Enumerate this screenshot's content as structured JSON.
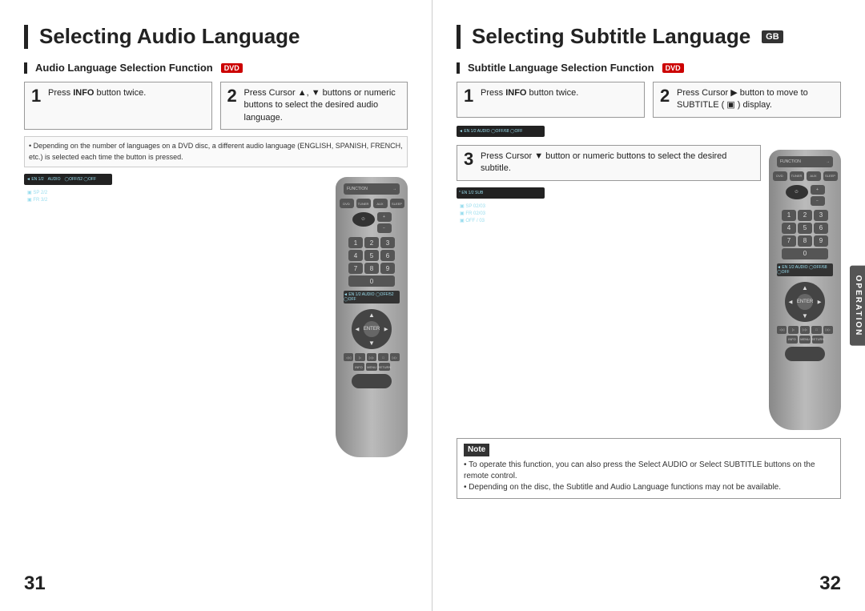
{
  "left": {
    "title": "Selecting Audio Language",
    "sub_bar": "|",
    "section_label": "Audio Language Selection Function",
    "dvd": "DVD",
    "step1": {
      "number": "1",
      "text": "Press ",
      "bold": "INFO",
      "text2": " button twice."
    },
    "step2": {
      "number": "2",
      "text": "Press Cursor ▲, ▼ buttons or numeric buttons to select the desired audio language."
    },
    "description": "• Depending on the number of languages on a DVD disc, a different audio language (ENGLISH, SPANISH, FRENCH, etc.) is selected each time the button is pressed.",
    "display_lines": [
      "◄ EN 1/2  AUDIO  ◯ OFF/ 52  ◯ OFF",
      "▣ SP 2/2",
      "▣ FR 3/2"
    ],
    "page_number": "31"
  },
  "right": {
    "title": "Selecting Subtitle Language",
    "gb_badge": "GB",
    "section_label": "Subtitle Language Selection Function",
    "dvd": "DVD",
    "step1": {
      "number": "1",
      "text": "Press ",
      "bold": "INFO",
      "text2": " button twice."
    },
    "step2": {
      "number": "2",
      "text": "Press Cursor ▶ button to move to SUBTITLE ( ▣ ) display."
    },
    "step3": {
      "number": "3",
      "text": "Press Cursor ▼ button or numeric buttons to select the desired subtitle."
    },
    "display_lines_top": [
      "◄ EN 1/2  AUDIO  ◯ OFF/ 68  ◯ OFF"
    ],
    "display_lines_bottom": [
      "* EN 1/2  SUB",
      "▣ SP 02/03",
      "▣ FR 02/03",
      "▣ OFF / 03"
    ],
    "note_title": "Note",
    "note_text": "• To operate this function, you can also press the Select AUDIO or Select SUBTITLE buttons on the remote control.\n• Depending on the disc, the Subtitle and Audio Language functions may not be available.",
    "operation_tab": "OPERATION",
    "page_number": "32"
  }
}
